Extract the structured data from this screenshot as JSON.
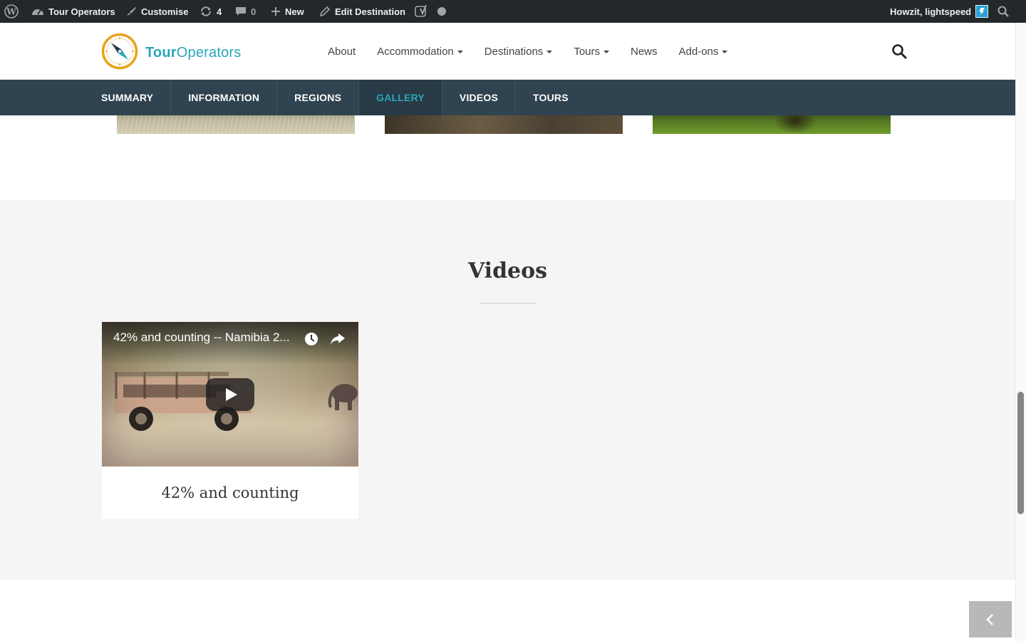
{
  "adminbar": {
    "site_name": "Tour Operators",
    "customise": "Customise",
    "updates_count": "4",
    "comments_count": "0",
    "new_label": "New",
    "edit_label": "Edit Destination",
    "greeting": "Howzit, lightspeed"
  },
  "header": {
    "logo_bold": "Tour",
    "logo_light": "Operators",
    "nav": [
      {
        "label": "About"
      },
      {
        "label": "Accommodation"
      },
      {
        "label": "Destinations"
      },
      {
        "label": "Tours"
      },
      {
        "label": "News"
      },
      {
        "label": "Add-ons"
      }
    ]
  },
  "subnav": {
    "items": [
      {
        "label": "SUMMARY"
      },
      {
        "label": "INFORMATION"
      },
      {
        "label": "REGIONS"
      },
      {
        "label": "GALLERY"
      },
      {
        "label": "VIDEOS"
      },
      {
        "label": "TOURS"
      }
    ],
    "active": "GALLERY"
  },
  "videos": {
    "section_title": "Videos",
    "items": [
      {
        "overlay_title": "42% and counting -- Namibia 2...",
        "caption": "42% and counting"
      }
    ]
  },
  "colors": {
    "brand": "#2aa5b8",
    "subnav_bg": "#2f4350",
    "adminbar_bg": "#23282d"
  },
  "icons": [
    "wordpress-icon",
    "dashboard-icon",
    "brush-icon",
    "updates-icon",
    "comment-icon",
    "plus-icon",
    "pencil-icon",
    "yoast-icon",
    "search-icon",
    "clock-icon",
    "share-icon",
    "play-icon",
    "chevron-left-icon"
  ]
}
